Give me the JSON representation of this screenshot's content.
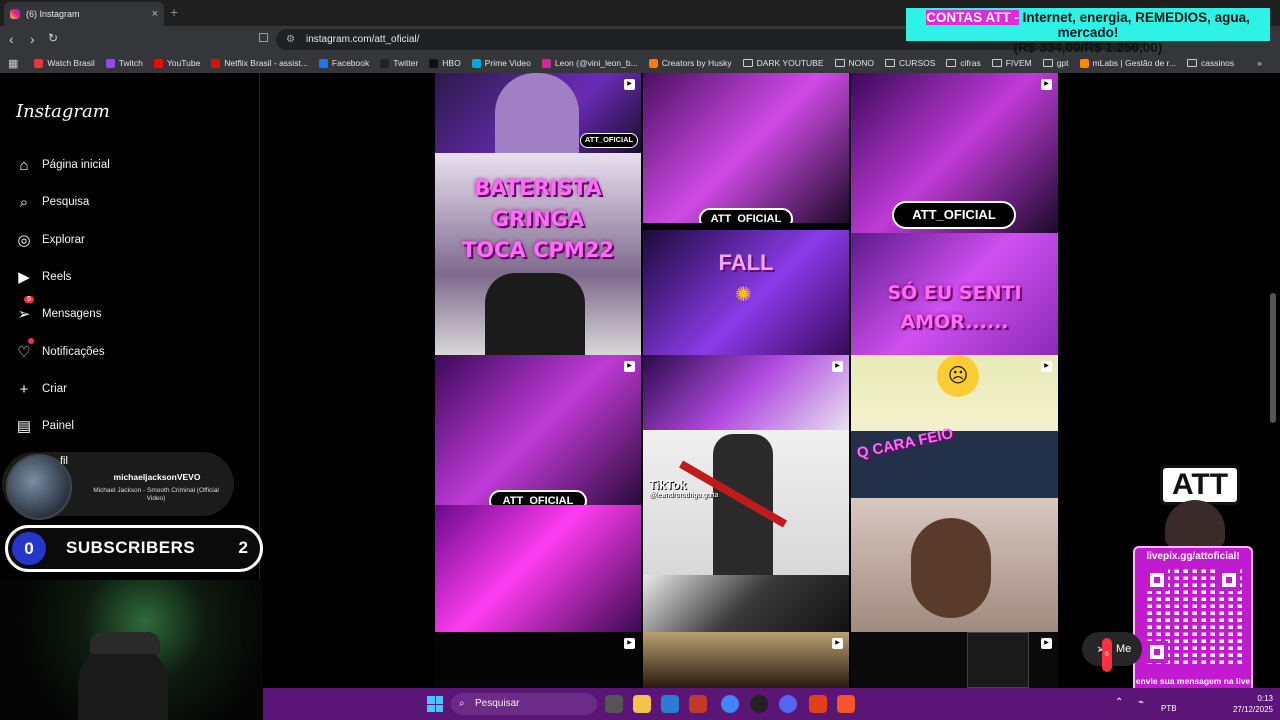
{
  "browser": {
    "tab_title": "(6) Instagram",
    "tab_close": "×",
    "new_tab": "+",
    "url": "instagram.com/att_oficial/",
    "bookmarks": [
      {
        "label": "Watch Brasil",
        "color": "#e53935"
      },
      {
        "label": "Twitch",
        "color": "#9146ff"
      },
      {
        "label": "YouTube",
        "color": "#ff0000"
      },
      {
        "label": "Netflix Brasil - assist...",
        "color": "#e50914"
      },
      {
        "label": "Facebook",
        "color": "#1877f2"
      },
      {
        "label": "Twitter",
        "color": "#222222"
      },
      {
        "label": "HBO",
        "color": "#111111"
      },
      {
        "label": "Prime Video",
        "color": "#00a8e1"
      },
      {
        "label": "Leon (@vini_leon_b...",
        "color": "#d6249f"
      },
      {
        "label": "Creators by Husky",
        "color": "#ff7a00"
      },
      {
        "label": "DARK YOUTUBE",
        "color": "folder"
      },
      {
        "label": "NONO",
        "color": "folder"
      },
      {
        "label": "CURSOS",
        "color": "folder"
      },
      {
        "label": "cifras",
        "color": "folder"
      },
      {
        "label": "FIVEM",
        "color": "folder"
      },
      {
        "label": "gpt",
        "color": "folder"
      },
      {
        "label": "mLabs | Gestão de r...",
        "color": "#ff8a00"
      },
      {
        "label": "cassinos",
        "color": "folder"
      }
    ],
    "more_bookmarks": "»"
  },
  "banner": {
    "prefix": "CONTAS ATT -",
    "text": " Internet, energia, REMEDIOS, agua, mercado!",
    "line2": "(R$ 334,00/R$ 1.250,00)"
  },
  "instagram": {
    "logo": "Instagram",
    "nav": [
      {
        "label": "Página inicial",
        "icon": "⌂",
        "name": "home-icon"
      },
      {
        "label": "Pesquisa",
        "icon": "⌕",
        "name": "search-icon"
      },
      {
        "label": "Explorar",
        "icon": "◎",
        "name": "explore-icon"
      },
      {
        "label": "Reels",
        "icon": "▶",
        "name": "reels-icon"
      },
      {
        "label": "Mensagens",
        "icon": "➢",
        "name": "messages-icon",
        "badge": "6"
      },
      {
        "label": "Notificações",
        "icon": "♡",
        "name": "heart-icon",
        "dot": true
      },
      {
        "label": "Criar",
        "icon": "+",
        "name": "plus-icon"
      },
      {
        "label": "Painel",
        "icon": "▤",
        "name": "dashboard-icon"
      }
    ],
    "profile_partial": "fil",
    "grid": {
      "att_pill": "ATT_OFICIAL",
      "caption_baterista": [
        "BATERISTA",
        "GRINGA",
        "TOCA CPM22"
      ],
      "caption_fall": "FALL",
      "caption_amor": [
        "SÓ EU SENTI",
        "AMOR......"
      ],
      "caption_qcara": "Q CARA FEIO",
      "tiktok": "TikTok",
      "tiktok_handle": "@leandrorodrigo.guita"
    },
    "messages_pill": {
      "label": "Me",
      "badge": "6"
    }
  },
  "overlay": {
    "song_artist": "michaeljacksonVEVO",
    "song_title": "Michael Jackson - Smooth Criminal (Official Video)",
    "sub_left": "0",
    "sub_label": "SUBSCRIBERS",
    "sub_right": "2",
    "att_logo": "ATT",
    "livepix_url": "livepix.gg/attoficial!",
    "livepix_msg": "envie sua mensagem na live via pix!"
  },
  "taskbar": {
    "search_placeholder": "Pesquisar",
    "lang": "PTB",
    "time": "0:13",
    "date": "27/12/2025"
  }
}
